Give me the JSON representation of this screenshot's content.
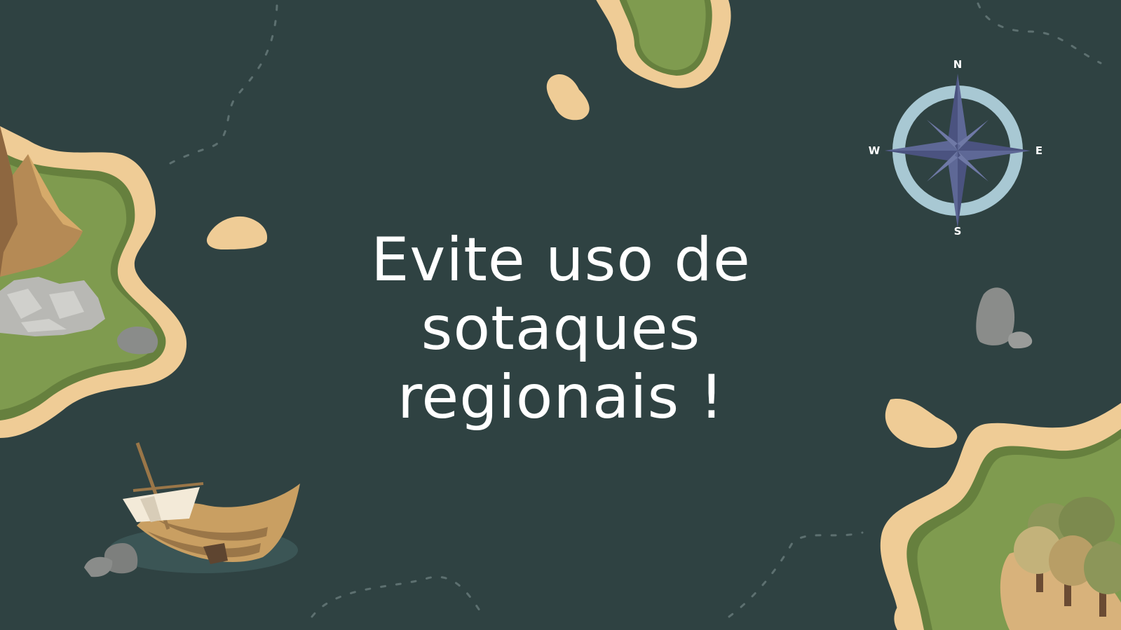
{
  "slide": {
    "headline_lines": [
      "Evite uso de",
      "sotaques",
      "regionais !"
    ],
    "compass": {
      "north": "N",
      "south": "S",
      "east": "E",
      "west": "W"
    },
    "colors": {
      "background": "#2f4242",
      "sand": "#efcc96",
      "grass": "#7f9b4f",
      "grass_edge": "#66803e",
      "compass_ring": "#a8c8d3",
      "compass_star": "#5e6896",
      "rock": "#8a8c8a",
      "text": "#ffffff"
    }
  }
}
